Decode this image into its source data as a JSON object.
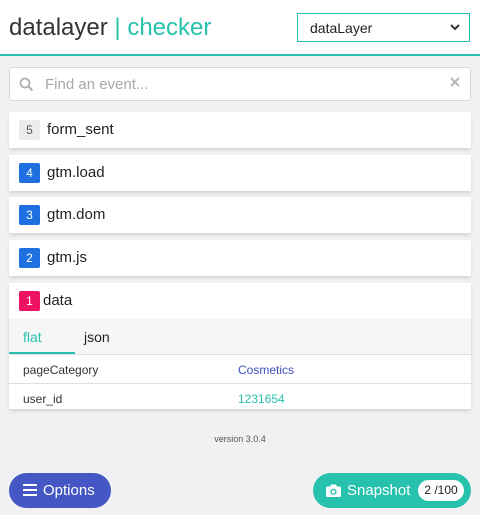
{
  "header": {
    "brand_left": "datalayer",
    "brand_sep": " | ",
    "brand_right": "checker",
    "layer_select": {
      "value": "dataLayer"
    }
  },
  "search": {
    "placeholder": "Find an event...",
    "value": ""
  },
  "events": [
    {
      "index": "5",
      "name": "form_sent"
    },
    {
      "index": "4",
      "name": "gtm.load"
    },
    {
      "index": "3",
      "name": "gtm.dom"
    },
    {
      "index": "2",
      "name": "gtm.js"
    },
    {
      "index": "1",
      "name": "data"
    }
  ],
  "detail": {
    "tabs": [
      {
        "label": "flat"
      },
      {
        "label": "json"
      }
    ],
    "active_tab": "flat",
    "rows": [
      {
        "key": "pageCategory",
        "value": "Cosmetics"
      },
      {
        "key": "user_id",
        "value": "1231654"
      }
    ]
  },
  "version": "version 3.0.4",
  "footer": {
    "options_label": "Options",
    "snapshot_label": "Snapshot",
    "snapshot_count": "2 /100"
  },
  "colors": {
    "accent": "#27c2ad",
    "options": "#4457c4",
    "badge_blue": "#1e6fe0",
    "badge_pink": "#ee1262",
    "string_value": "#3f4fc0",
    "number_value": "#27c2ad"
  },
  "icons": [
    "chevron-down-icon",
    "search-icon",
    "close-icon",
    "menu-icon",
    "camera-icon"
  ]
}
